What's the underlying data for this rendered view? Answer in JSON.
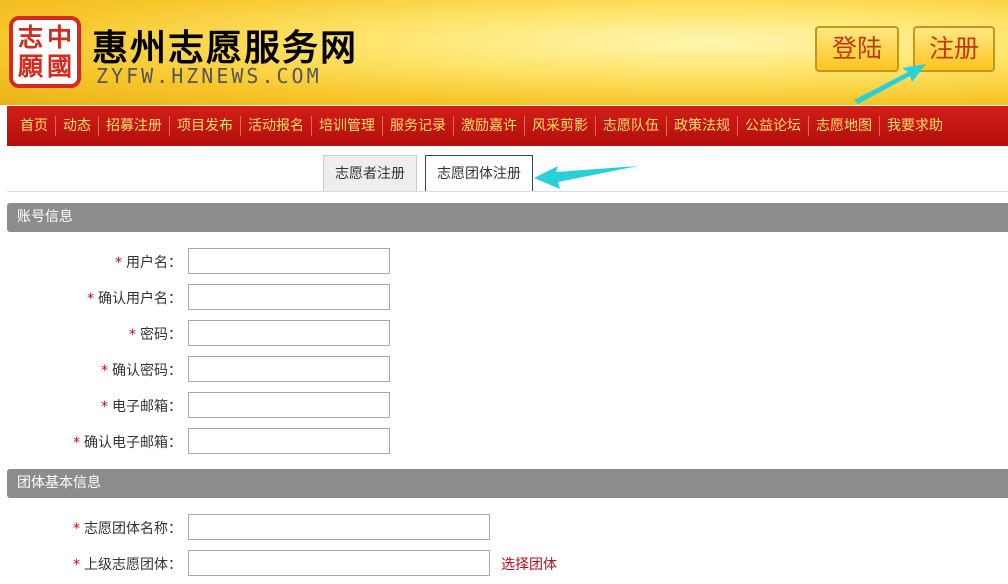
{
  "header": {
    "logo_chars": [
      "志",
      "中",
      "願",
      "國"
    ],
    "title": "惠州志愿服务网",
    "subtitle": "ZYFW.HZNEWS.COM",
    "login_label": "登陆",
    "register_label": "注册"
  },
  "nav": {
    "items": [
      "首页",
      "动态",
      "招募注册",
      "项目发布",
      "活动报名",
      "培训管理",
      "服务记录",
      "激励嘉许",
      "风采剪影",
      "志愿队伍",
      "政策法规",
      "公益论坛",
      "志愿地图",
      "我要求助"
    ]
  },
  "tabs": [
    {
      "label": "志愿者注册",
      "active": false
    },
    {
      "label": "志愿团体注册",
      "active": true
    }
  ],
  "sections": {
    "account": {
      "title": "账号信息",
      "fields": [
        {
          "label": "用户名：",
          "value": ""
        },
        {
          "label": "确认用户名：",
          "value": ""
        },
        {
          "label": "密码：",
          "value": ""
        },
        {
          "label": "确认密码：",
          "value": ""
        },
        {
          "label": "电子邮箱：",
          "value": ""
        },
        {
          "label": "确认电子邮箱：",
          "value": ""
        }
      ]
    },
    "group": {
      "title": "团体基本信息",
      "fields": [
        {
          "label": "志愿团体名称：",
          "value": ""
        },
        {
          "label": "上级志愿团体：",
          "value": ""
        }
      ],
      "select_group_link": "选择团体"
    }
  },
  "required_mark": "*",
  "colors": {
    "nav_bg": "#c8160f",
    "nav_text": "#ffe06a",
    "section_bar": "#8c8c8c",
    "required": "#c0101a",
    "annotation_arrow": "#2ad0d8"
  },
  "icons": {
    "annotation_arrows": [
      "arrow-to-register-icon",
      "arrow-to-group-tab-icon"
    ]
  }
}
